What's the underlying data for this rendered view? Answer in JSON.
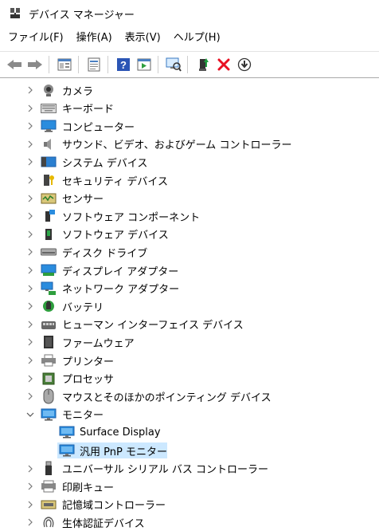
{
  "window": {
    "title": "デバイス マネージャー"
  },
  "menu": [
    "ファイル(F)",
    "操作(A)",
    "表示(V)",
    "ヘルプ(H)"
  ],
  "toolbar_icons": [
    "back-arrow-icon",
    "forward-arrow-icon",
    "properties-panel-icon",
    "document-icon",
    "help-icon",
    "run-panel-icon",
    "scan-hardware-icon",
    "update-driver-icon",
    "uninstall-x-icon",
    "download-circle-icon"
  ],
  "tree": [
    {
      "label": "カメラ",
      "icon": "camera-icon",
      "expanded": false
    },
    {
      "label": "キーボード",
      "icon": "keyboard-icon",
      "expanded": false
    },
    {
      "label": "コンピューター",
      "icon": "computer-icon",
      "expanded": false
    },
    {
      "label": "サウンド、ビデオ、およびゲーム コントローラー",
      "icon": "speaker-icon",
      "expanded": false
    },
    {
      "label": "システム デバイス",
      "icon": "system-device-icon",
      "expanded": false
    },
    {
      "label": "セキュリティ デバイス",
      "icon": "security-key-icon",
      "expanded": false
    },
    {
      "label": "センサー",
      "icon": "sensor-icon",
      "expanded": false
    },
    {
      "label": "ソフトウェア コンポーネント",
      "icon": "software-component-icon",
      "expanded": false
    },
    {
      "label": "ソフトウェア デバイス",
      "icon": "software-device-icon",
      "expanded": false
    },
    {
      "label": "ディスク ドライブ",
      "icon": "disk-drive-icon",
      "expanded": false
    },
    {
      "label": "ディスプレイ アダプター",
      "icon": "display-adapter-icon",
      "expanded": false
    },
    {
      "label": "ネットワーク アダプター",
      "icon": "network-adapter-icon",
      "expanded": false
    },
    {
      "label": "バッテリ",
      "icon": "battery-icon",
      "expanded": false
    },
    {
      "label": "ヒューマン インターフェイス デバイス",
      "icon": "hid-icon",
      "expanded": false
    },
    {
      "label": "ファームウェア",
      "icon": "firmware-icon",
      "expanded": false
    },
    {
      "label": "プリンター",
      "icon": "printer-icon",
      "expanded": false
    },
    {
      "label": "プロセッサ",
      "icon": "processor-icon",
      "expanded": false
    },
    {
      "label": "マウスとそのほかのポインティング デバイス",
      "icon": "mouse-icon",
      "expanded": false
    },
    {
      "label": "モニター",
      "icon": "monitor-icon",
      "expanded": true,
      "children": [
        {
          "label": "Surface Display",
          "icon": "monitor-icon",
          "selected": false
        },
        {
          "label": "汎用 PnP モニター",
          "icon": "monitor-icon",
          "selected": true
        }
      ]
    },
    {
      "label": "ユニバーサル シリアル バス コントローラー",
      "icon": "usb-icon",
      "expanded": false
    },
    {
      "label": "印刷キュー",
      "icon": "print-queue-icon",
      "expanded": false
    },
    {
      "label": "記憶域コントローラー",
      "icon": "storage-controller-icon",
      "expanded": false
    },
    {
      "label": "生体認証デバイス",
      "icon": "biometric-icon",
      "expanded": false
    }
  ],
  "colors": {
    "selection": "#cce8ff",
    "monitor_blue": "#1e78d7",
    "uninstall_red": "#e81123"
  }
}
